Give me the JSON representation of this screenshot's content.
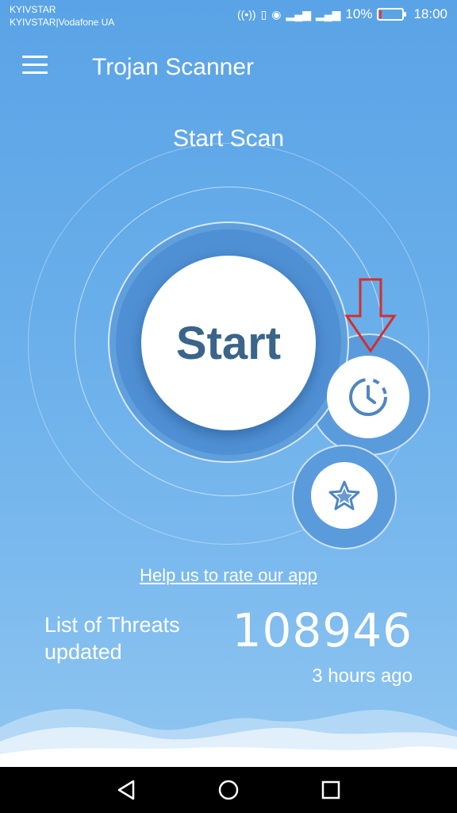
{
  "status_bar": {
    "carrier_line1": "KYIVSTAR",
    "carrier_line2": "KYIVSTAR|Vodafone UA",
    "battery": "10%",
    "battery_level": 0.1,
    "time": "18:00"
  },
  "app_bar": {
    "title": "Trojan Scanner"
  },
  "scan": {
    "heading": "Start Scan",
    "start_label": "Start"
  },
  "rate_link": "Help us to rate our app",
  "threats": {
    "label_line1": "List of Threats",
    "label_line2": "updated",
    "count": "108946",
    "updated_ago": "3 hours ago"
  },
  "colors": {
    "accent": "#5aa3e6",
    "start_text": "#3a6489",
    "annotation_arrow": "#d32f2f"
  }
}
